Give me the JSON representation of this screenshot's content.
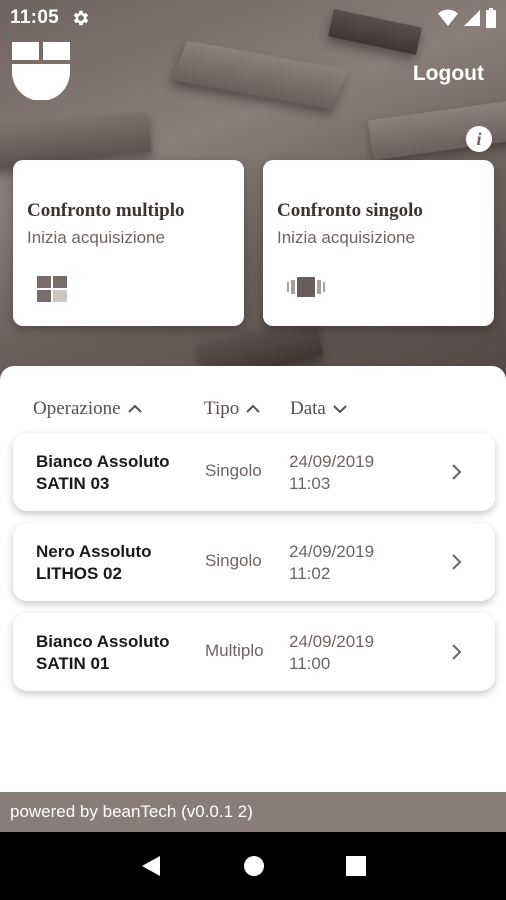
{
  "status_bar": {
    "time": "11:05"
  },
  "header": {
    "logout_label": "Logout",
    "info_label": "i"
  },
  "cards": [
    {
      "title": "Confronto multiplo",
      "subtitle": "Inizia acquisizione",
      "icon": "grid-icon"
    },
    {
      "title": "Confronto singolo",
      "subtitle": "Inizia acquisizione",
      "icon": "tile-compare-icon"
    }
  ],
  "table": {
    "headers": {
      "operazione": "Operazione",
      "tipo": "Tipo",
      "data": "Data"
    },
    "rows": [
      {
        "name_line1": "Bianco Assoluto",
        "name_line2": "SATIN 03",
        "tipo": "Singolo",
        "date": "24/09/2019",
        "time": "11:03"
      },
      {
        "name_line1": "Nero Assoluto",
        "name_line2": "LITHOS 02",
        "tipo": "Singolo",
        "date": "24/09/2019",
        "time": "11:02"
      },
      {
        "name_line1": "Bianco Assoluto",
        "name_line2": "SATIN 01",
        "tipo": "Multiplo",
        "date": "24/09/2019",
        "time": "11:00"
      }
    ]
  },
  "footer": {
    "text": "powered by beanTech  (v0.0.1 2)"
  },
  "colors": {
    "brand": "#8a7d79",
    "card_title": "#3d3432",
    "secondary_text": "#6e6562"
  }
}
